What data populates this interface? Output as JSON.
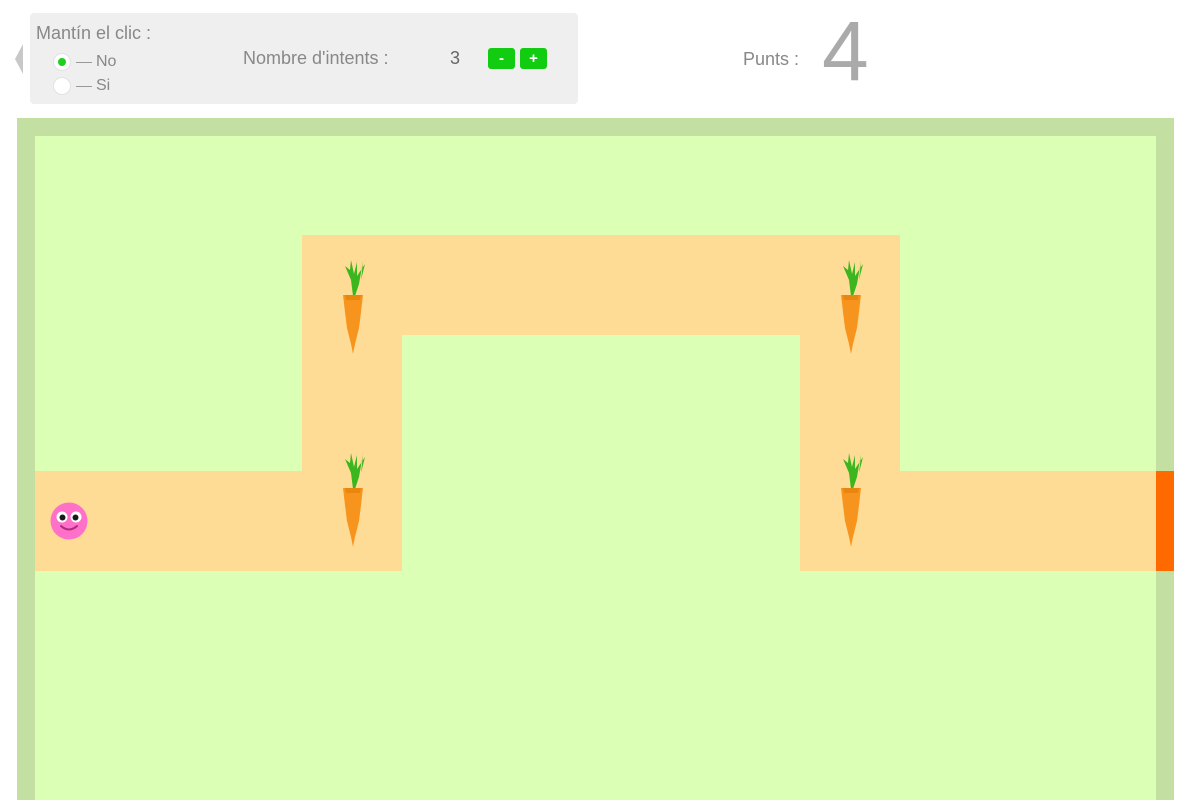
{
  "controls": {
    "hold_click_label": "Mantín el clic :",
    "options": [
      {
        "label": "No",
        "selected": true
      },
      {
        "label": "Si",
        "selected": false
      }
    ],
    "attempts_label": "Nombre d'intents :",
    "attempts_value": "3",
    "decrease_label": "-",
    "increase_label": "+"
  },
  "score": {
    "label": "Punts :",
    "value": "4"
  },
  "game": {
    "carrots_remaining": 4,
    "colors": {
      "border": "#c3e0a2",
      "grass": "#dbffb4",
      "path": "#ffdc96",
      "exit": "#ff6a00",
      "player": "#ff70c8",
      "carrot": "#f7941d",
      "leaves": "#3cb61f",
      "button": "#11cc11"
    },
    "icons": [
      "back-arrow-icon",
      "carrot-icon",
      "smiley-player-icon"
    ]
  }
}
